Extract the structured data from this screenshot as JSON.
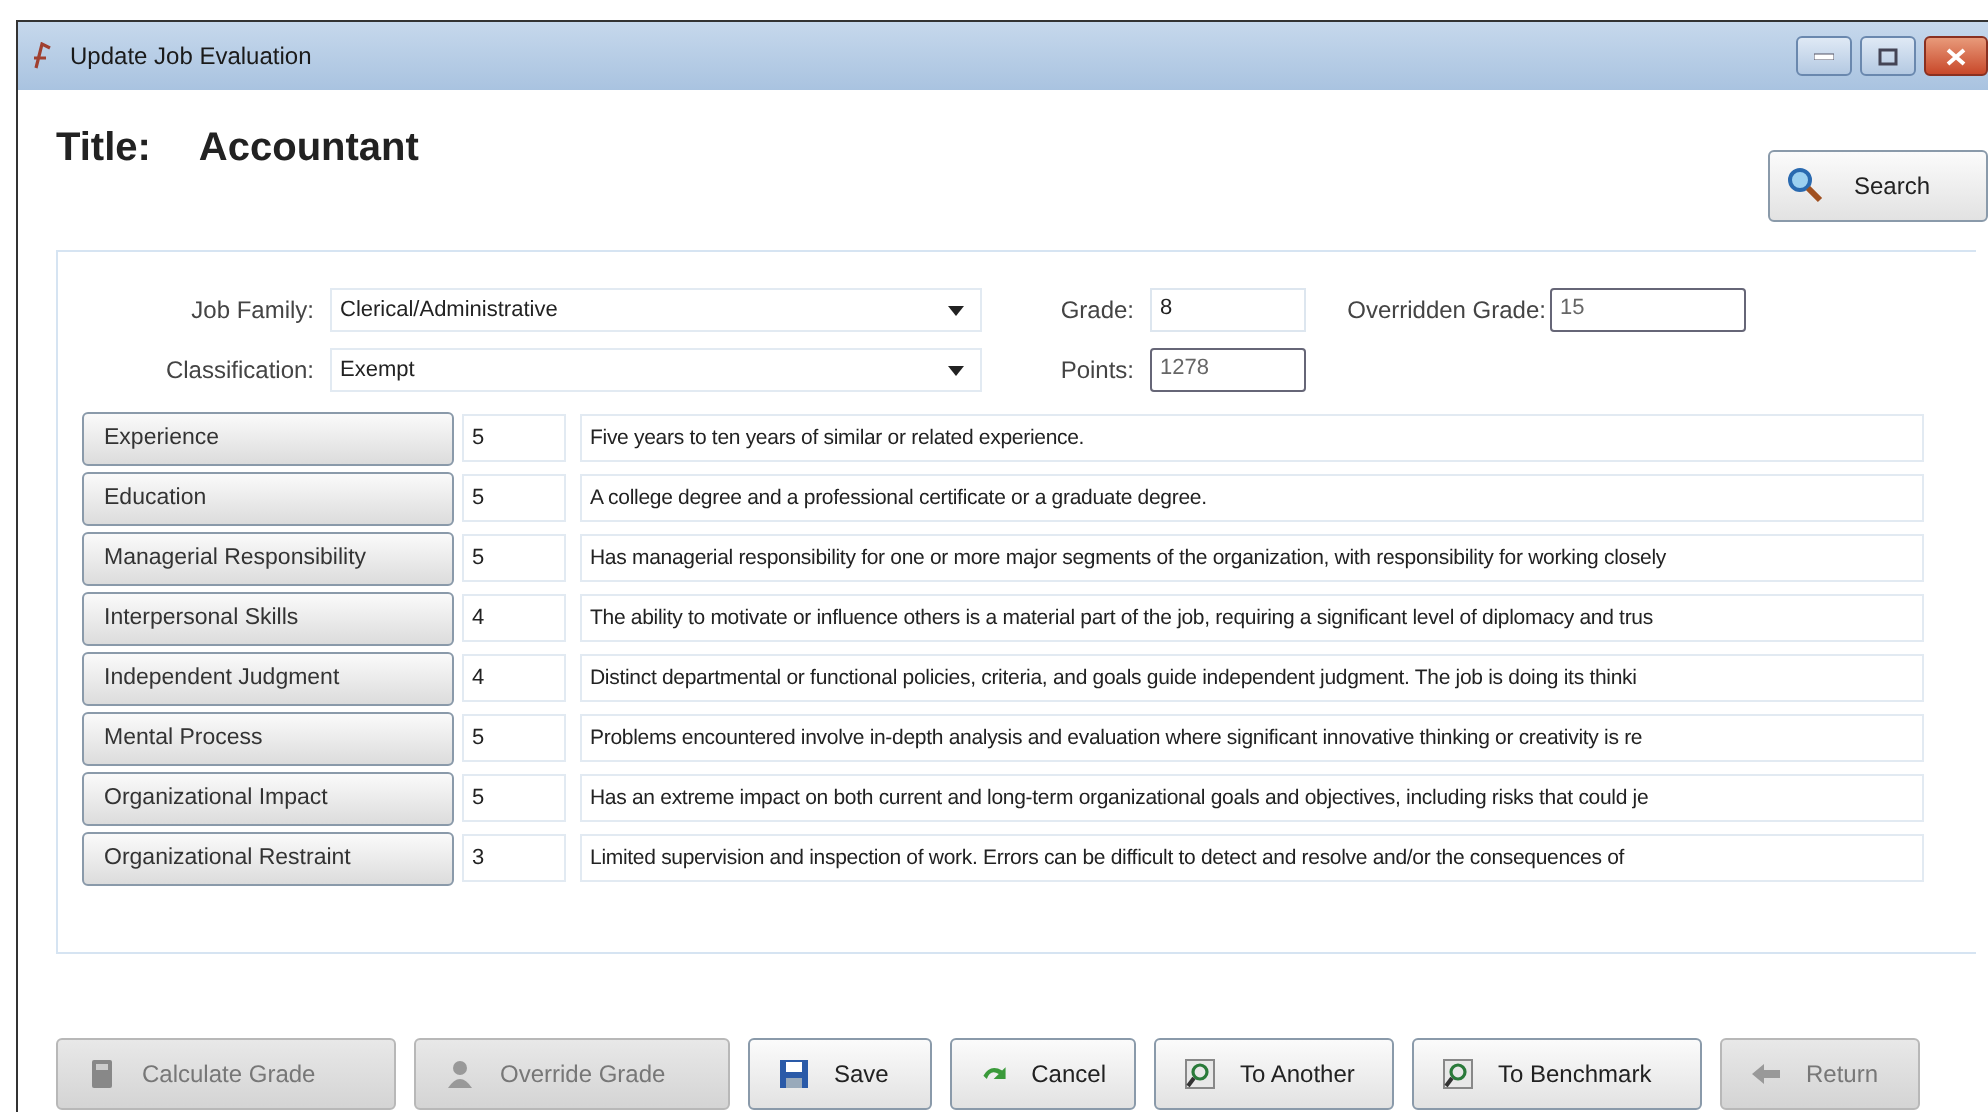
{
  "window": {
    "title": "Update Job Evaluation"
  },
  "header": {
    "label": "Title:",
    "value": "Accountant"
  },
  "search_button": {
    "label": "Search"
  },
  "fields": {
    "job_family": {
      "label": "Job Family:",
      "value": "Clerical/Administrative"
    },
    "classification": {
      "label": "Classification:",
      "value": "Exempt"
    },
    "grade": {
      "label": "Grade:",
      "value": "8"
    },
    "overridden_grade": {
      "label": "Overridden Grade:",
      "value": "15"
    },
    "points": {
      "label": "Points:",
      "value": "1278"
    }
  },
  "factors": [
    {
      "label": "Experience",
      "score": "5",
      "description": "Five years to ten years of similar or related experience."
    },
    {
      "label": "Education",
      "score": "5",
      "description": "A college degree and a professional certificate or a graduate degree."
    },
    {
      "label": "Managerial Responsibility",
      "score": "5",
      "description": "Has managerial responsibility for one or more major segments of the organization, with responsibility for working closely"
    },
    {
      "label": "Interpersonal Skills",
      "score": "4",
      "description": "The ability to motivate or influence others is a material part of the job, requiring a significant level of diplomacy and trus"
    },
    {
      "label": "Independent Judgment",
      "score": "4",
      "description": "Distinct departmental or functional policies, criteria, and goals guide independent judgment.  The job is doing its thinki"
    },
    {
      "label": "Mental Process",
      "score": "5",
      "description": "Problems encountered involve in-depth analysis and evaluation where significant innovative thinking or creativity is re"
    },
    {
      "label": "Organizational Impact",
      "score": "5",
      "description": "Has an extreme impact on both current and long-term organizational goals and objectives, including risks that could je"
    },
    {
      "label": "Organizational Restraint",
      "score": "3",
      "description": "Limited supervision and inspection of work.  Errors can be difficult to detect and resolve and/or the consequences of"
    }
  ],
  "buttons": [
    {
      "label": "Calculate Grade",
      "kind": "calculator",
      "disabled": true
    },
    {
      "label": "Override Grade",
      "kind": "person",
      "disabled": true
    },
    {
      "label": "Save",
      "kind": "disk",
      "disabled": false
    },
    {
      "label": "Cancel",
      "kind": "undo",
      "disabled": false
    },
    {
      "label": "To Another",
      "kind": "magnifier",
      "disabled": false
    },
    {
      "label": "To Benchmark",
      "kind": "magnifier",
      "disabled": false
    },
    {
      "label": "Return",
      "kind": "arrow",
      "disabled": true
    }
  ]
}
